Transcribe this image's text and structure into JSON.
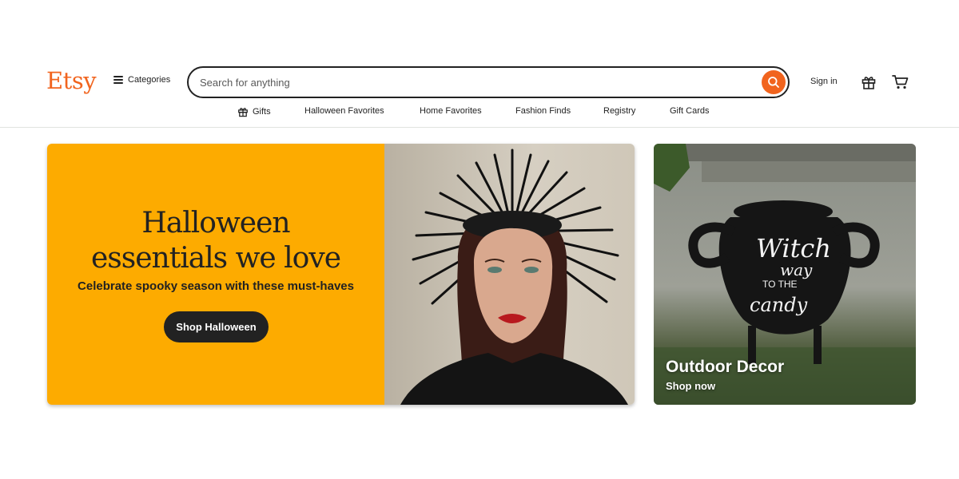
{
  "header": {
    "logo": "Etsy",
    "categories_label": "Categories",
    "search_placeholder": "Search for anything",
    "signin_label": "Sign in"
  },
  "subnav": {
    "items": [
      {
        "label": "Gifts",
        "icon": "gift-icon"
      },
      {
        "label": "Halloween Favorites"
      },
      {
        "label": "Home Favorites"
      },
      {
        "label": "Fashion Finds"
      },
      {
        "label": "Registry"
      },
      {
        "label": "Gift Cards"
      }
    ]
  },
  "hero": {
    "title_line1": "Halloween",
    "title_line2": "essentials we love",
    "subtitle": "Celebrate spooky season with these must-haves",
    "button_label": "Shop Halloween",
    "background_color": "#fdab00"
  },
  "side_card": {
    "label": "Outdoor Decor",
    "cta": "Shop now",
    "sign_text_1": "Witch",
    "sign_text_2": "way",
    "sign_text_3": "TO THE",
    "sign_text_4": "candy"
  },
  "colors": {
    "brand": "#f1641e",
    "dark": "#222222"
  }
}
